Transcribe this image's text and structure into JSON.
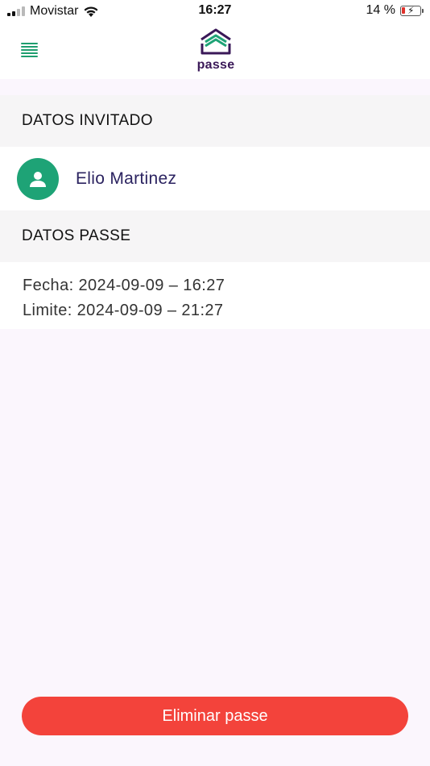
{
  "status_bar": {
    "carrier": "Movistar",
    "time": "16:27",
    "battery_percent": "14 %",
    "signal_bars_filled": 2,
    "signal_bars_total": 4
  },
  "header": {
    "logo_text": "passe",
    "menu_icon": "hamburger-icon"
  },
  "guest_section": {
    "title": "DATOS INVITADO",
    "guest_name": "Elio Martinez",
    "avatar_icon": "person-icon"
  },
  "pass_section": {
    "title": "DATOS PASSE",
    "fecha": "Fecha: 2024-09-09 – 16:27",
    "limite": "Limite: 2024-09-09 – 21:27"
  },
  "actions": {
    "delete_label": "Eliminar passe"
  },
  "colors": {
    "accent_green": "#1ea376",
    "brand_purple": "#3a1858",
    "danger": "#f3433b",
    "background": "#fbf6fd"
  }
}
